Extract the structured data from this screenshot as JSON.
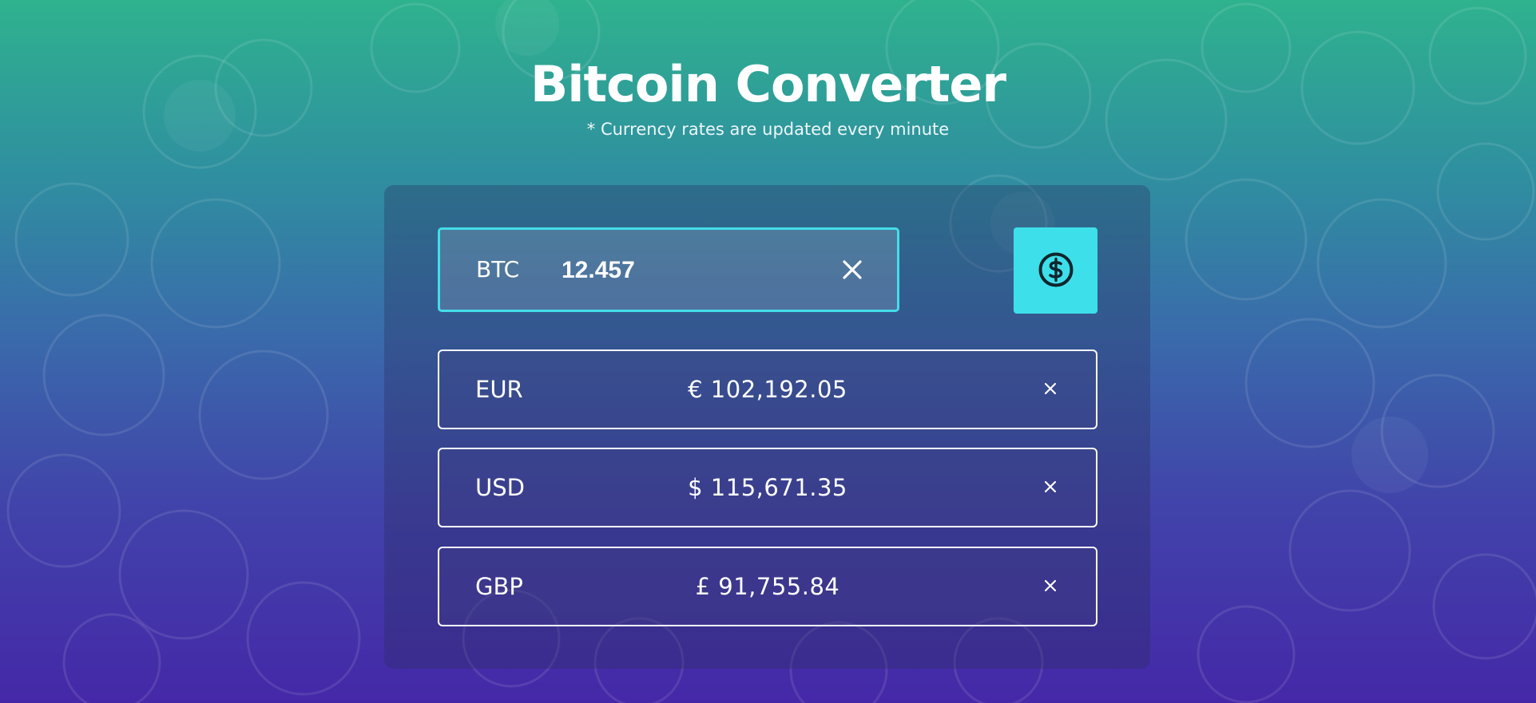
{
  "header": {
    "title": "Bitcoin Converter",
    "subtitle": "* Currency rates are updated every minute"
  },
  "converter": {
    "source_currency": "BTC",
    "amount": "12.457",
    "clear_icon": "close-icon",
    "convert_button_icon": "dollar-circle-icon",
    "accent_color": "#3de0ea"
  },
  "results": [
    {
      "code": "EUR",
      "value": "€ 102,192.05",
      "remove_icon": "close-icon"
    },
    {
      "code": "USD",
      "value": "$ 115,671.35",
      "remove_icon": "close-icon"
    },
    {
      "code": "GBP",
      "value": "£ 91,755.84",
      "remove_icon": "close-icon"
    }
  ]
}
